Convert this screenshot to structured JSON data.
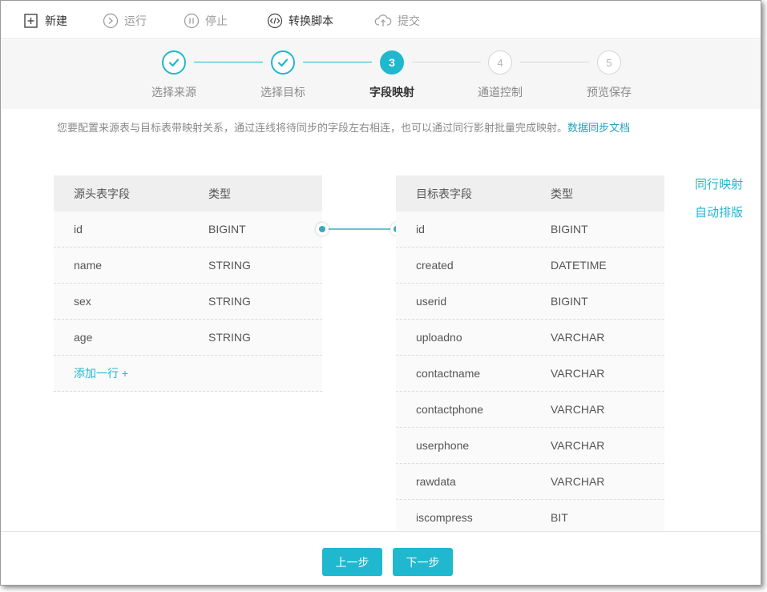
{
  "toolbar": {
    "new_label": "新建",
    "run_label": "运行",
    "stop_label": "停止",
    "convert_label": "转换脚本",
    "submit_label": "提交"
  },
  "steps": {
    "items": [
      {
        "label": "选择来源",
        "state": "done"
      },
      {
        "label": "选择目标",
        "state": "done"
      },
      {
        "label": "字段映射",
        "state": "active",
        "number": "3"
      },
      {
        "label": "通道控制",
        "state": "todo",
        "number": "4"
      },
      {
        "label": "预览保存",
        "state": "todo",
        "number": "5"
      }
    ]
  },
  "description": {
    "text": "您要配置来源表与目标表带映射关系，通过连线将待同步的字段左右相连，也可以通过同行影射批量完成映射。",
    "link": "数据同步文档"
  },
  "source_table": {
    "header_field": "源头表字段",
    "header_type": "类型",
    "rows": [
      {
        "field": "id",
        "type": "BIGINT"
      },
      {
        "field": "name",
        "type": "STRING"
      },
      {
        "field": "sex",
        "type": "STRING"
      },
      {
        "field": "age",
        "type": "STRING"
      }
    ],
    "add_row_label": "添加一行 +"
  },
  "target_table": {
    "header_field": "目标表字段",
    "header_type": "类型",
    "rows": [
      {
        "field": "id",
        "type": "BIGINT"
      },
      {
        "field": "created",
        "type": "DATETIME"
      },
      {
        "field": "userid",
        "type": "BIGINT"
      },
      {
        "field": "uploadno",
        "type": "VARCHAR"
      },
      {
        "field": "contactname",
        "type": "VARCHAR"
      },
      {
        "field": "contactphone",
        "type": "VARCHAR"
      },
      {
        "field": "userphone",
        "type": "VARCHAR"
      },
      {
        "field": "rawdata",
        "type": "VARCHAR"
      },
      {
        "field": "iscompress",
        "type": "BIT"
      }
    ]
  },
  "side_actions": {
    "same_row_label": "同行映射",
    "auto_layout_label": "自动排版"
  },
  "footer": {
    "prev_label": "上一步",
    "next_label": "下一步"
  },
  "colors": {
    "accent": "#1fb8cf",
    "connector": "#3aa9bf"
  }
}
